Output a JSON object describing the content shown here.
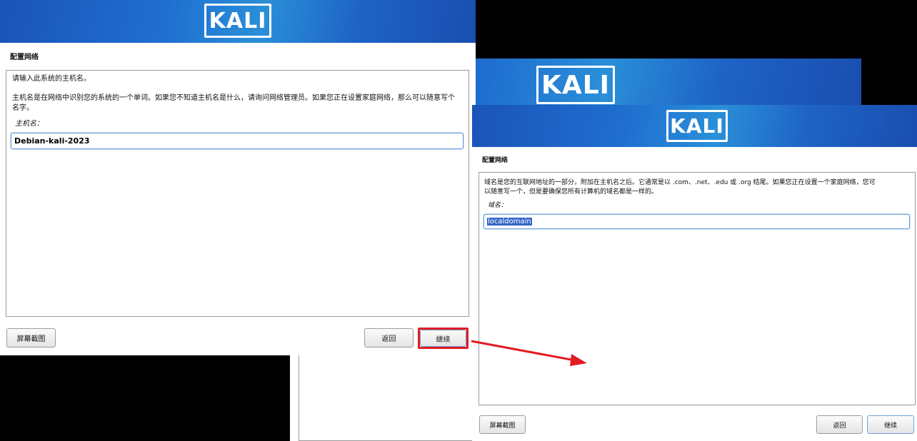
{
  "logo": {
    "text": "KALI"
  },
  "left_window": {
    "section_title": "配置网络",
    "line1": "请输入此系统的主机名。",
    "line2": "主机名是在网络中识别您的系统的一个单词。如果您不知道主机名是什么，请询问网络管理员。如果您正在设置家庭网络，那么可以随意写个",
    "line3": "名字。",
    "field_label": "主机名：",
    "field_value": "Debian-kali-2023",
    "screenshot_button": "屏幕截图",
    "back_button": "返回",
    "continue_button": "继续"
  },
  "middle_window": {},
  "right_window": {
    "section_title": "配置网络",
    "line1": "域名是您的互联网地址的一部分，附加在主机名之后。它通常是以 .com、.net、.edu 或 .org 结尾。如果您正在设置一个家庭网络，您可",
    "line2": "以随意写一个，但是要确保您所有计算机的域名都是一样的。",
    "field_label": "域名：",
    "field_value": "localdomain",
    "screenshot_button": "屏幕截图",
    "back_button": "返回",
    "continue_button": "继续"
  },
  "colors": {
    "highlight": "#e31b23",
    "arrow": "#e31b23",
    "banner": "#1f6fd0",
    "selection": "#3465c8"
  }
}
